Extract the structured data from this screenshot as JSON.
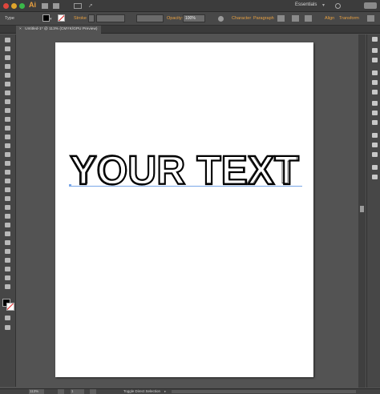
{
  "app": {
    "logo": "Ai"
  },
  "menu": {
    "workspace": "Essentials"
  },
  "control": {
    "type_label": "Type",
    "stroke_label": "Stroke",
    "opacity_label": "Opacity:",
    "opacity_value": "100%",
    "character": "Character",
    "paragraph": "Paragraph",
    "align": "Align",
    "transform": "Transform"
  },
  "document": {
    "tab_title": "Untitled-1* @ 113% (CMYK/GPU Preview)",
    "close": "×"
  },
  "artboard": {
    "text": "YOUR TEXT"
  },
  "status": {
    "zoom": "113%",
    "page": "1",
    "mode": "Toggle Direct Selection"
  },
  "colors": {
    "accent_orange": "#e8a040",
    "guide_blue": "#7aa7e8",
    "bg": "#535353"
  }
}
